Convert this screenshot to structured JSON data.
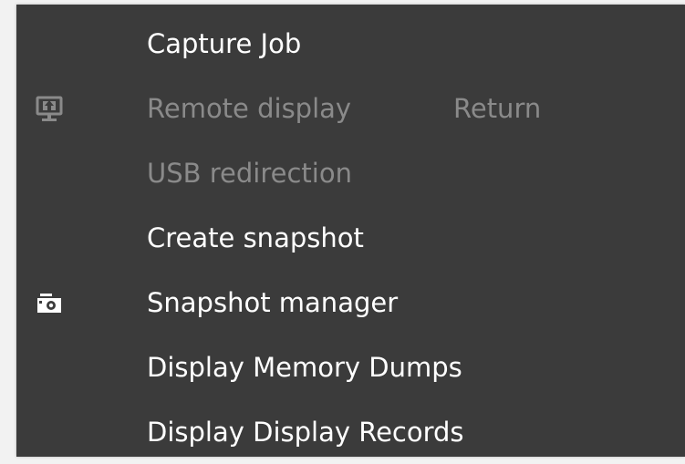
{
  "menu": {
    "items": [
      {
        "label": "Capture Job",
        "enabled": true
      },
      {
        "label": "Remote display",
        "shortcut": "Return",
        "icon": "remote-display-icon",
        "enabled": false
      },
      {
        "label": "USB redirection",
        "enabled": false
      },
      {
        "label": "Create snapshot",
        "enabled": true
      },
      {
        "label": "Snapshot manager",
        "icon": "camera-icon",
        "enabled": true
      },
      {
        "label": "Display Memory Dumps",
        "enabled": true
      },
      {
        "label": "Display Display Records",
        "enabled": true
      }
    ]
  },
  "colors": {
    "menu_background": "#3b3b3b",
    "text_enabled": "#ffffff",
    "text_disabled": "#8a8a8a"
  }
}
